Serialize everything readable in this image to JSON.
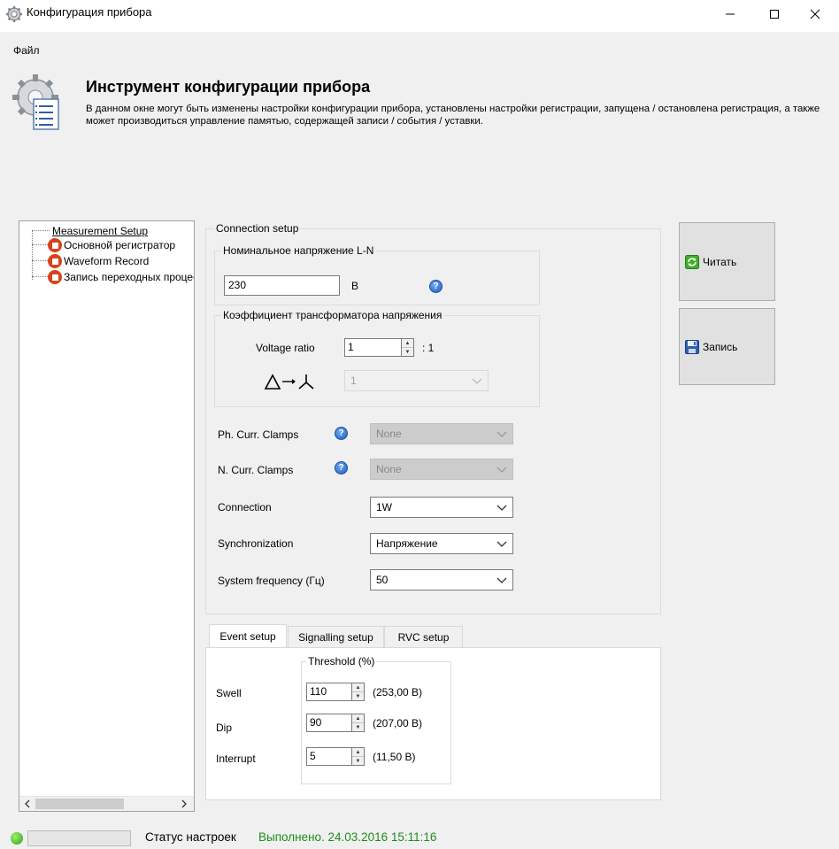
{
  "window": {
    "title": "Конфигурация прибора",
    "icon": "gear-icon"
  },
  "menu": {
    "file": "Файл"
  },
  "header": {
    "title": "Инструмент конфигурации прибора",
    "description": "В данном окне могут быть изменены настройки конфигурации прибора, установлены настройки регистрации, запущена / остановлена регистрация, а также может производиться управление памятью, содержащей записи / события / уставки."
  },
  "tree": {
    "root": "Measurement Setup",
    "items": [
      {
        "label": "Основной регистратор"
      },
      {
        "label": "Waveform Record"
      },
      {
        "label": "Запись переходных процессов"
      }
    ]
  },
  "connection": {
    "group_title": "Connection setup",
    "nominal": {
      "group_title": "Номинальное напряжение L-N",
      "value": "230",
      "unit": "В"
    },
    "ratio": {
      "group_title": "Коэффициент трансформатора напряжения",
      "label": "Voltage ratio",
      "value": "1",
      "suffix": ": 1",
      "delta_value": "1"
    },
    "ph_clamps": {
      "label": "Ph. Curr. Clamps",
      "value": "None"
    },
    "n_clamps": {
      "label": "N. Curr. Clamps",
      "value": "None"
    },
    "connection": {
      "label": "Connection",
      "value": "1W"
    },
    "sync": {
      "label": "Synchronization",
      "value": "Напряжение"
    },
    "freq": {
      "label": "System frequency (Гц)",
      "value": "50"
    }
  },
  "tabs": [
    {
      "label": "Event setup",
      "active": true
    },
    {
      "label": "Signalling setup",
      "active": false
    },
    {
      "label": "RVC setup",
      "active": false
    }
  ],
  "event_setup": {
    "threshold_title": "Threshold (%)",
    "rows": [
      {
        "label": "Swell",
        "value": "110",
        "computed": "(253,00 В)"
      },
      {
        "label": "Dip",
        "value": "90",
        "computed": "(207,00 В)"
      },
      {
        "label": "Interrupt",
        "value": "5",
        "computed": "(11,50 В)"
      }
    ]
  },
  "buttons": {
    "read": "Читать",
    "write": "Запись"
  },
  "status": {
    "label": "Статус настроек",
    "value": "Выполнено. 24.03.2016 15:11:16"
  },
  "colors": {
    "status_ok": "#1e8c1e",
    "node_icon": "#d7431d"
  }
}
